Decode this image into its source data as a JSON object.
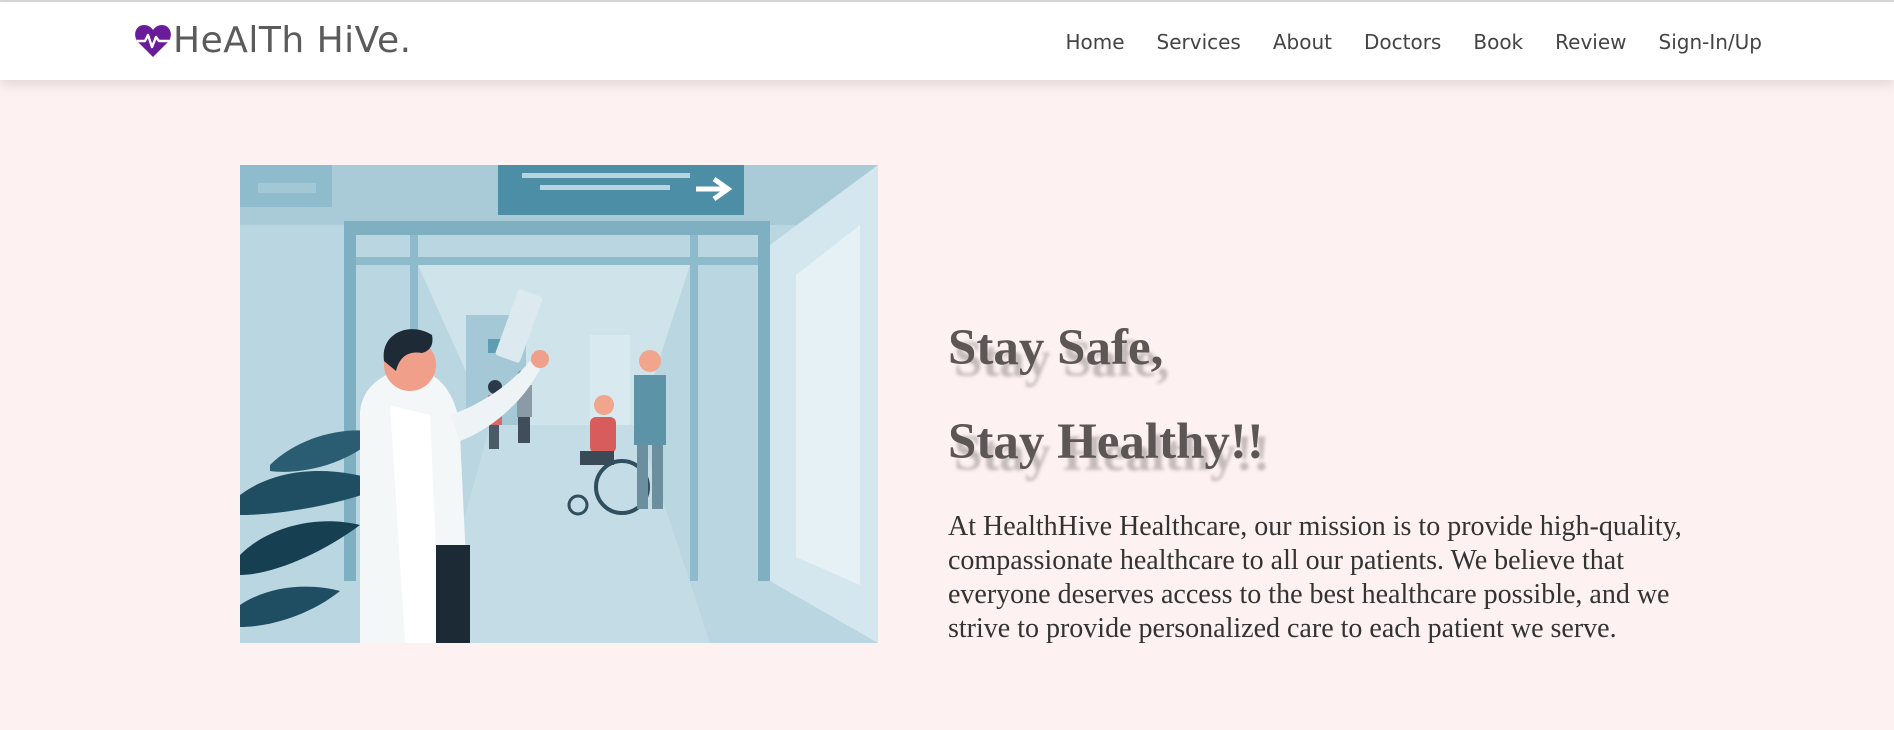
{
  "header": {
    "brand": "HeAlTh HiVe.",
    "nav": [
      "Home",
      "Services",
      "About",
      "Doctors",
      "Book",
      "Review",
      "Sign-In/Up"
    ]
  },
  "hero": {
    "image_icon": "hospital-corridor-illustration",
    "heading_line1": "Stay Safe,",
    "heading_line2": "Stay Healthy!!",
    "description": "At HealthHive Healthcare, our mission is to provide high-quality, compassionate healthcare to all our patients. We believe that everyone deserves access to the best healthcare possible, and we strive to provide personalized care to each patient we serve."
  },
  "colors": {
    "brand_purple": "#6a1b9a",
    "page_background": "#fdf1f1",
    "heading": "#5d5656"
  }
}
